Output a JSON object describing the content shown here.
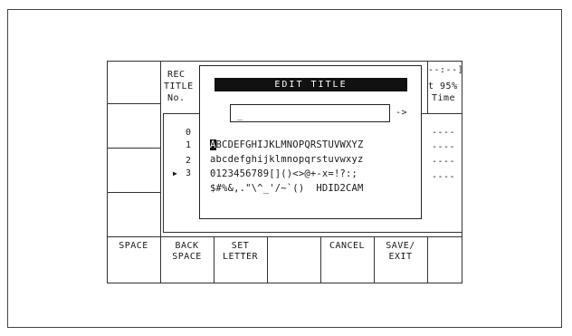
{
  "header": {
    "rec": "REC",
    "title": "TITLE",
    "no": "No.",
    "right_top": "--:--]",
    "right_mid": "t 95%",
    "right_bot": "Time"
  },
  "list": {
    "rows": [
      "0",
      "1",
      "2",
      "3"
    ],
    "selected_marker": "▶",
    "right_dashes": [
      "----",
      "----",
      "----",
      "----"
    ]
  },
  "dialog": {
    "title": "EDIT TITLE",
    "input_value": "_",
    "arrow": "->",
    "selected_char": "A",
    "row1_rest": "BCDEFGHIJKLMNOPQRSTUVWXYZ",
    "row2": "abcdefghijklmnopqrstuvwxyz",
    "row3": "0123456789[]()<>@+-x=!?:;",
    "row4": "$#%&,.\"\\^_'/~`()  HDID2CAM"
  },
  "softkeys": {
    "b1": "SPACE",
    "b2": "BACK\nSPACE",
    "b3": "SET\nLETTER",
    "b4": "",
    "b5": "CANCEL",
    "b6": "SAVE/\nEXIT",
    "b7": ""
  }
}
